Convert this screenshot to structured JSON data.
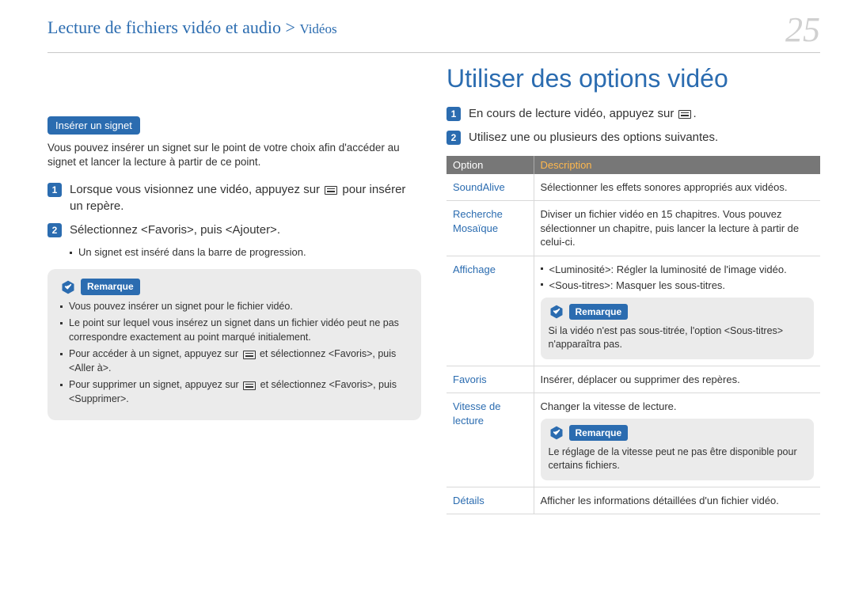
{
  "header": {
    "breadcrumb_main": "Lecture de fichiers vidéo et audio > ",
    "breadcrumb_sub": "Vidéos",
    "page_number": "25"
  },
  "left": {
    "section_label": "Insérer un signet",
    "intro": "Vous pouvez insérer un signet sur le point de votre choix afin d'accéder au signet et lancer la lecture à partir de ce point.",
    "step1_a": "Lorsque vous visionnez une vidéo, appuyez sur ",
    "step1_b": " pour insérer un repère.",
    "step2": "Sélectionnez <Favoris>, puis <Ajouter>.",
    "step2_sub": "Un signet est inséré dans la barre de progression.",
    "note_label": "Remarque",
    "note_items": {
      "i1": "Vous pouvez insérer un signet pour le fichier vidéo.",
      "i2": "Le point sur lequel vous insérez un signet dans un fichier vidéo peut ne pas correspondre exactement au point marqué initialement.",
      "i3a": "Pour accéder à un signet, appuyez sur ",
      "i3b": " et sélectionnez <Favoris>, puis <Aller à>.",
      "i4a": "Pour supprimer un signet, appuyez sur ",
      "i4b": " et sélectionnez <Favoris>, puis <Supprimer>."
    }
  },
  "right": {
    "heading": "Utiliser des options vidéo",
    "step1_a": "En cours de lecture vidéo, appuyez sur ",
    "step1_b": ".",
    "step2": "Utilisez une ou plusieurs des options suivantes.",
    "th_option": "Option",
    "th_desc": "Description",
    "rows": {
      "soundalive": {
        "name": "SoundAlive",
        "desc": "Sélectionner les effets sonores appropriés aux vidéos."
      },
      "recherche": {
        "name": "Recherche Mosaïque",
        "desc": "Diviser un fichier vidéo en 15 chapitres. Vous pouvez sélectionner un chapitre, puis lancer la lecture à partir de celui-ci."
      },
      "affichage": {
        "name": "Affichage",
        "b1": "<Luminosité>: Régler la luminosité de l'image vidéo.",
        "b2": "<Sous-titres>: Masquer les sous-titres.",
        "note_label": "Remarque",
        "note": "Si la vidéo n'est pas sous-titrée, l'option <Sous-titres> n'apparaîtra pas."
      },
      "favoris": {
        "name": "Favoris",
        "desc": "Insérer, déplacer ou supprimer des repères."
      },
      "vitesse": {
        "name": "Vitesse de lecture",
        "desc": "Changer la vitesse de lecture.",
        "note_label": "Remarque",
        "note": "Le réglage de la vitesse peut ne pas être disponible pour certains fichiers."
      },
      "details": {
        "name": "Détails",
        "desc": "Afficher les informations détaillées d'un fichier vidéo."
      }
    }
  }
}
